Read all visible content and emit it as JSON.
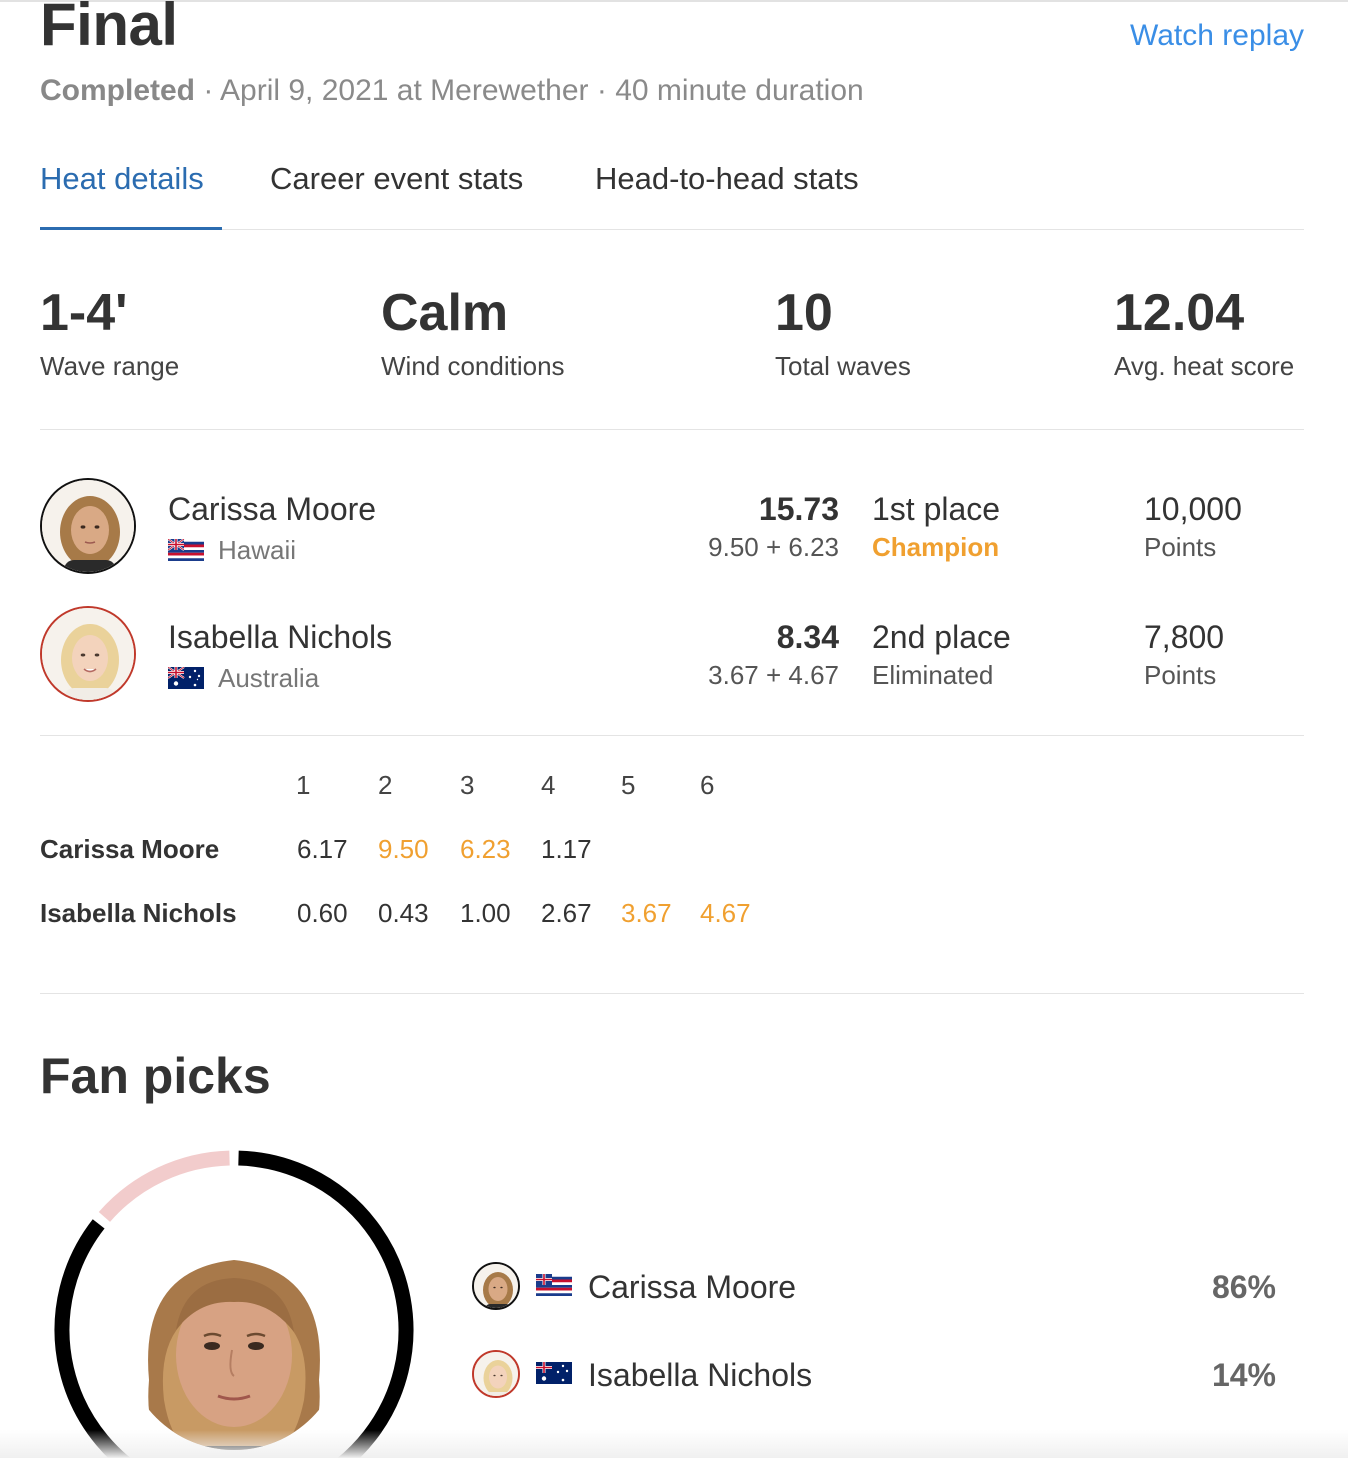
{
  "header": {
    "title": "Final",
    "watch_replay": "Watch replay",
    "status": "Completed",
    "date_location": " · April 9, 2021 at Merewether · 40 minute duration"
  },
  "tabs": [
    {
      "label": "Heat details",
      "active": true
    },
    {
      "label": "Career event stats",
      "active": false
    },
    {
      "label": "Head-to-head stats",
      "active": false
    }
  ],
  "stats": [
    {
      "value": "1-4'",
      "label": "Wave range"
    },
    {
      "value": "Calm",
      "label": "Wind conditions"
    },
    {
      "value": "10",
      "label": "Total waves"
    },
    {
      "value": "12.04",
      "label": "Avg. heat score"
    }
  ],
  "athletes": [
    {
      "name": "Carissa Moore",
      "country": "Hawaii",
      "flag": "hawaii-flag",
      "total": "15.73",
      "counting_waves": "9.50 + 6.23",
      "place": "1st place",
      "result": "Champion",
      "points": "10,000",
      "points_label": "Points",
      "ring_color": "#111111"
    },
    {
      "name": "Isabella Nichols",
      "country": "Australia",
      "flag": "australia-flag",
      "total": "8.34",
      "counting_waves": "3.67 + 4.67",
      "place": "2nd place",
      "result": "Eliminated",
      "points": "7,800",
      "points_label": "Points",
      "ring_color": "#c0392b"
    }
  ],
  "wave_scores": {
    "columns": [
      "1",
      "2",
      "3",
      "4",
      "5",
      "6"
    ],
    "rows": [
      {
        "name": "Carissa Moore",
        "scores": [
          "6.17",
          "9.50",
          "6.23",
          "1.17"
        ],
        "counting": [
          false,
          true,
          true,
          false
        ]
      },
      {
        "name": "Isabella Nichols",
        "scores": [
          "0.60",
          "0.43",
          "1.00",
          "2.67",
          "3.67",
          "4.67"
        ],
        "counting": [
          false,
          false,
          false,
          false,
          true,
          true
        ]
      }
    ],
    "highlight_color": "#f0a030"
  },
  "fan_picks": {
    "title": "Fan picks",
    "picks": [
      {
        "name": "Carissa Moore",
        "percent": "86%",
        "share": 0.86,
        "color": "#000000"
      },
      {
        "name": "Isabella Nichols",
        "percent": "14%",
        "share": 0.14,
        "color": "#f2cccc"
      }
    ]
  },
  "colors": {
    "accent_blue": "#2b6cb0",
    "link_blue": "#3a8ee6",
    "champion_orange": "#f0a030"
  }
}
